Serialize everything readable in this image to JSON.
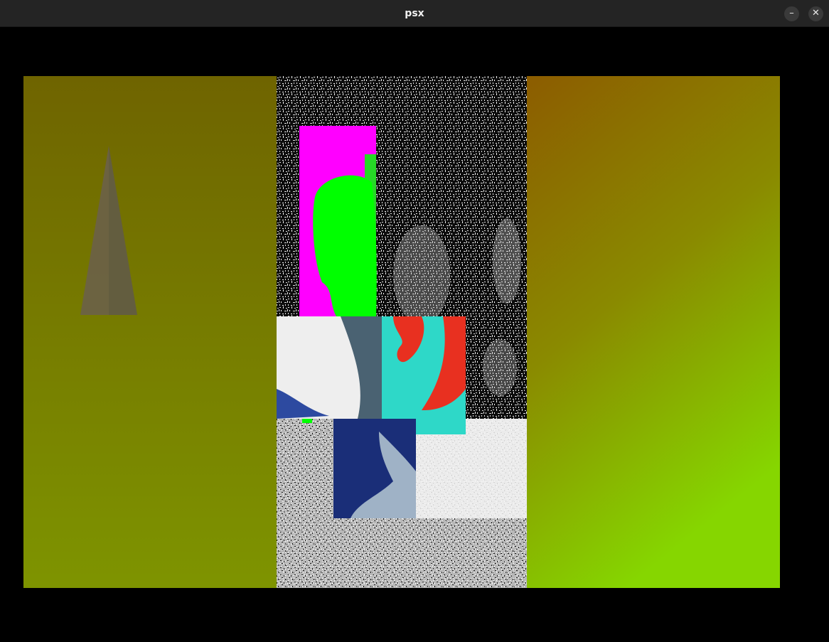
{
  "window": {
    "title": "psx",
    "minimize_glyph": "–",
    "close_glyph": "✕"
  },
  "colors": {
    "titlebar": "#242424",
    "background": "#000000",
    "gradient_top_left": "#6f6400",
    "gradient_top_right": "#8c5c00",
    "gradient_bottom_left": "#7e9400",
    "gradient_bottom_right": "#86d600",
    "triangle": "#6b6048",
    "magenta": "#ff00ff",
    "green": "#00ff00",
    "cyan": "#2ed8c8",
    "red": "#e83020",
    "navy": "#1a2e78"
  },
  "icons": {
    "minimize": "minimize-icon",
    "close": "close-icon"
  }
}
